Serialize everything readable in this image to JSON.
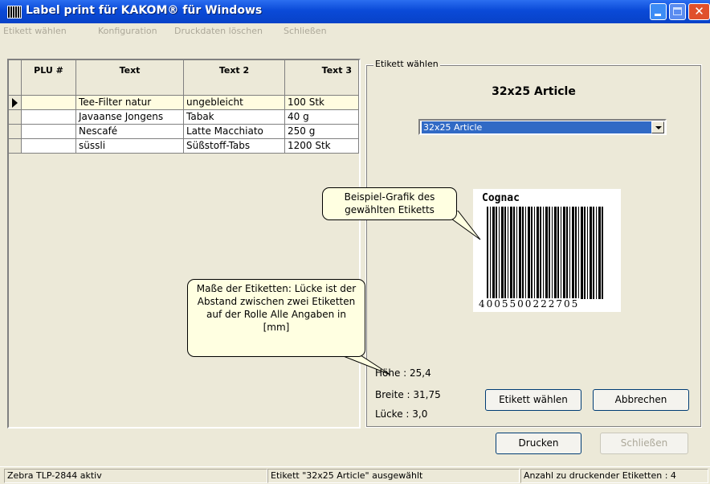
{
  "window": {
    "title": "Label print für KAKOM® für Windows",
    "icon": "barcode-app-icon",
    "accent": "#0a4ad8"
  },
  "menu": [
    "Etikett wählen",
    "Konfiguration",
    "Druckdaten löschen",
    "Schließen"
  ],
  "table": {
    "columns": [
      "PLU #",
      "Text",
      "Text 2",
      "Text 3"
    ],
    "rows": [
      {
        "plu": "",
        "text": "Tee-Filter natur",
        "text2": "ungebleicht",
        "text3": "100 Stk",
        "selected": true
      },
      {
        "plu": "",
        "text": "Javaanse Jongens",
        "text2": "Tabak",
        "text3": "40 g",
        "selected": false
      },
      {
        "plu": "",
        "text": "Nescafé",
        "text2": "Latte Macchiato",
        "text3": "250 g",
        "selected": false
      },
      {
        "plu": "",
        "text": "süssli",
        "text2": "Süßstoff-Tabs",
        "text3": "1200 Stk",
        "selected": false
      }
    ]
  },
  "label_panel": {
    "group_title": "Etikett wählen",
    "heading": "32x25 Article",
    "selected_option": "32x25 Article",
    "preview": {
      "title": "Cognac",
      "barcode_number": "4005500222705"
    },
    "dimensions": {
      "hoehe": "Höhe : 25,4",
      "breite": "Breite  : 31,75",
      "luecke": "Lücke   : 3,0"
    },
    "select_button": "Etikett wählen",
    "cancel_button": "Abbrechen"
  },
  "callouts": {
    "preview": "Beispiel-Grafik des gewählten Etiketts",
    "sizes": "Maße der Etiketten: Lücke ist der Abstand zwischen zwei Etiketten auf der Rolle Alle Angaben in [mm]"
  },
  "footer_buttons": {
    "print": "Drucken",
    "close": "Schließen"
  },
  "status": {
    "printer": "Zebra TLP-2844 aktiv",
    "label": "Etikett \"32x25 Article\" ausgewählt",
    "count": "Anzahl zu druckender Etiketten : 4"
  }
}
